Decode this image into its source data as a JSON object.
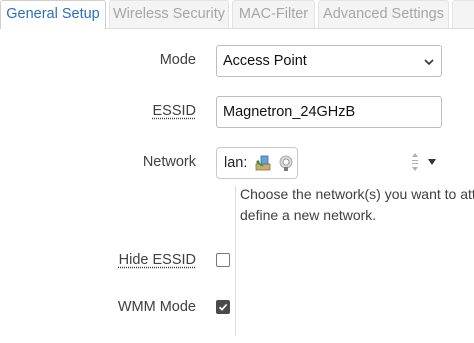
{
  "tabs": [
    {
      "label": "General Setup",
      "active": true
    },
    {
      "label": "Wireless Security",
      "active": false
    },
    {
      "label": "MAC-Filter",
      "active": false
    },
    {
      "label": "Advanced Settings",
      "active": false
    }
  ],
  "form": {
    "mode": {
      "label": "Mode",
      "value": "Access Point"
    },
    "essid": {
      "label": "ESSID",
      "value": "Magnetron_24GHzB"
    },
    "network": {
      "label": "Network",
      "value": "lan:",
      "icons": [
        "ethernet-icon",
        "wifi-icon"
      ],
      "help_line1": "Choose the network(s) you want to atta",
      "help_line2": "define a new network."
    },
    "hide_essid": {
      "label": "Hide ESSID",
      "checked": false
    },
    "wmm_mode": {
      "label": "WMM Mode",
      "checked": true
    }
  },
  "colors": {
    "accent": "#2a6fc1",
    "text": "#404040",
    "checkbox_checked": "#4a4a4a"
  }
}
